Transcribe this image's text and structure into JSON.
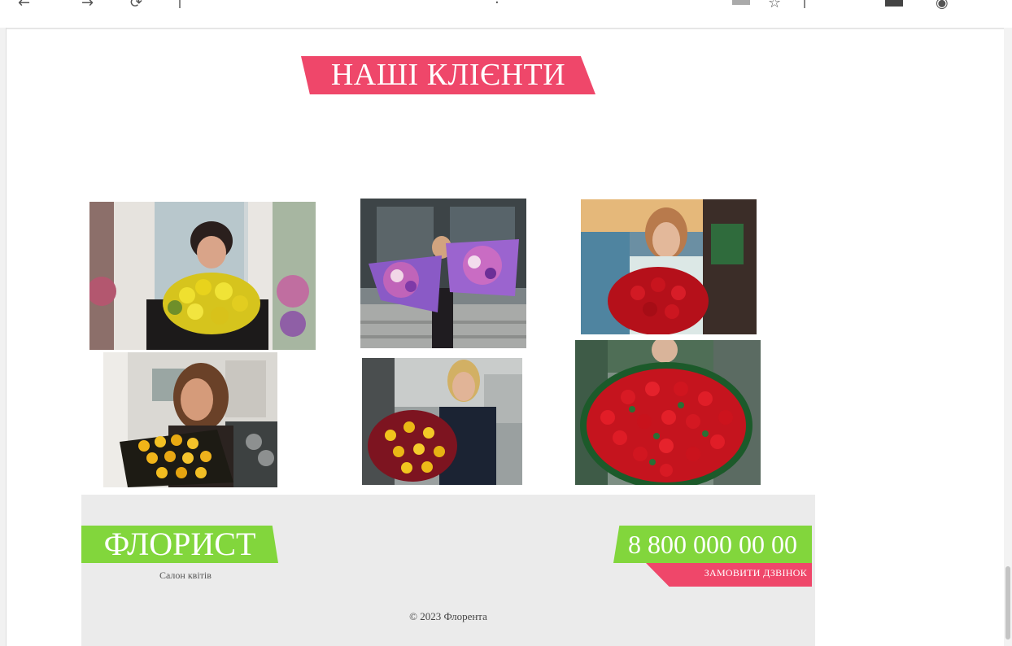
{
  "section": {
    "heading": "НАШІ КЛІЄНТИ"
  },
  "gallery": {
    "photos": [
      {
        "description_icon": "client-photo-yellow-roses-icon",
        "accent": "#e8d11a"
      },
      {
        "description_icon": "client-photo-purple-bouquets-icon",
        "accent": "#8a4fbf"
      },
      {
        "description_icon": "client-photo-red-roses-icon",
        "accent": "#c4121a"
      },
      {
        "description_icon": "client-photo-yellow-tulips-icon",
        "accent": "#e0a51c"
      },
      {
        "description_icon": "client-photo-red-yellow-roses-icon",
        "accent": "#b01526"
      },
      {
        "description_icon": "client-photo-big-red-bouquet-icon",
        "accent": "#c8121f"
      }
    ]
  },
  "footer": {
    "logo": "ФЛОРИСТ",
    "tagline": "Салон квітів",
    "phone": "8 800 000 00 00",
    "callback": "ЗАМОВИТИ ДЗВІНОК",
    "copyright": "© 2023 Флорента"
  },
  "colors": {
    "pink": "#ef476a",
    "green": "#82d63c",
    "footer_bg": "#ebebeb"
  }
}
